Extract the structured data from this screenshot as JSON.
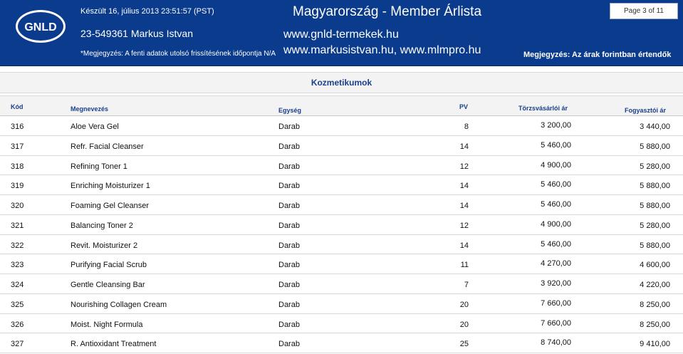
{
  "header": {
    "created": "Készült 16, július 2013 23:51:57 (PST)",
    "distributor": "23-549361  Markus Istvan",
    "note_left": "*Megjegyzés: A fenti adatok utolsó frissítésének időpontja N/A",
    "title": "Magyarország - Member Árlista",
    "website_1": "www.gnld-termekek.hu",
    "website_2": "www.markusistvan.hu, www.mlmpro.hu",
    "page": "Page 3 of 11",
    "note_right": "Megjegyzés: Az árak forintban értendők",
    "logo_text": "GNLD"
  },
  "section_title": "Kozmetikumok",
  "columns": {
    "code": "Kód",
    "name": "Megnevezés",
    "unit": "Egység",
    "pv": "PV",
    "distributor_price": "Törzsvásárlói ár",
    "consumer_price": "Fogyasztói ár"
  },
  "rows": [
    {
      "code": "316",
      "name": "Aloe Vera Gel",
      "unit": "Darab",
      "pv": "8",
      "distributor_price": "3 200,00",
      "consumer_price": "3 440,00"
    },
    {
      "code": "317",
      "name": "Refr. Facial Cleanser",
      "unit": "Darab",
      "pv": "14",
      "distributor_price": "5 460,00",
      "consumer_price": "5 880,00"
    },
    {
      "code": "318",
      "name": "Refining Toner 1",
      "unit": "Darab",
      "pv": "12",
      "distributor_price": "4 900,00",
      "consumer_price": "5 280,00"
    },
    {
      "code": "319",
      "name": "Enriching Moisturizer 1",
      "unit": "Darab",
      "pv": "14",
      "distributor_price": "5 460,00",
      "consumer_price": "5 880,00"
    },
    {
      "code": "320",
      "name": "Foaming Gel Cleanser",
      "unit": "Darab",
      "pv": "14",
      "distributor_price": "5 460,00",
      "consumer_price": "5 880,00"
    },
    {
      "code": "321",
      "name": "Balancing Toner 2",
      "unit": "Darab",
      "pv": "12",
      "distributor_price": "4 900,00",
      "consumer_price": "5 280,00"
    },
    {
      "code": "322",
      "name": "Revit. Moisturizer 2",
      "unit": "Darab",
      "pv": "14",
      "distributor_price": "5 460,00",
      "consumer_price": "5 880,00"
    },
    {
      "code": "323",
      "name": "Purifying Facial Scrub",
      "unit": "Darab",
      "pv": "11",
      "distributor_price": "4 270,00",
      "consumer_price": "4 600,00"
    },
    {
      "code": "324",
      "name": "Gentle Cleansing Bar",
      "unit": "Darab",
      "pv": "7",
      "distributor_price": "3 920,00",
      "consumer_price": "4 220,00"
    },
    {
      "code": "325",
      "name": "Nourishing Collagen Cream",
      "unit": "Darab",
      "pv": "20",
      "distributor_price": "7 660,00",
      "consumer_price": "8 250,00"
    },
    {
      "code": "326",
      "name": "Moist. Night Formula",
      "unit": "Darab",
      "pv": "20",
      "distributor_price": "7 660,00",
      "consumer_price": "8 250,00"
    },
    {
      "code": "327",
      "name": "R. Antioxidant Treatment",
      "unit": "Darab",
      "pv": "25",
      "distributor_price": "8 740,00",
      "consumer_price": "9 410,00"
    }
  ]
}
